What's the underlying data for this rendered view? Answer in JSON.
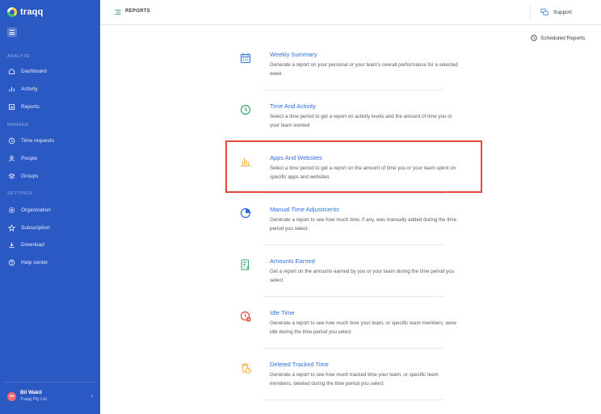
{
  "app": {
    "name": "traqq"
  },
  "sidebar": {
    "sections": {
      "analyze": "ANALYZE",
      "manage": "MANAGE",
      "settings": "SETTINGS"
    },
    "analyze_items": [
      {
        "label": "Dashboard",
        "icon": "home-icon"
      },
      {
        "label": "Activity",
        "icon": "activity-bars-icon"
      },
      {
        "label": "Reports",
        "icon": "reports-icon"
      }
    ],
    "manage_items": [
      {
        "label": "Time requests",
        "icon": "clock-icon"
      },
      {
        "label": "People",
        "icon": "people-icon"
      },
      {
        "label": "Groups",
        "icon": "groups-icon"
      }
    ],
    "settings_items": [
      {
        "label": "Organization",
        "icon": "gear-icon"
      },
      {
        "label": "Subscription",
        "icon": "star-icon"
      },
      {
        "label": "Download",
        "icon": "download-icon"
      },
      {
        "label": "Help center",
        "icon": "help-icon"
      }
    ],
    "user": {
      "name": "Bil Wakil",
      "org": "Traqq Pty Ltd",
      "initials": "BW"
    }
  },
  "header": {
    "title": "REPORTS",
    "support": "Support"
  },
  "scheduled": {
    "label": "Scheduled Reports"
  },
  "reports": [
    {
      "title": "Weekly Summary",
      "desc": "Generate a report on your personal or your team's overall performance for a selected week",
      "icon": "calendar-icon",
      "color": "#2f6fdd"
    },
    {
      "title": "Time And Activity",
      "desc": "Select a time period to get a report on activity levels and the amount of time you or your team worked",
      "icon": "clock-icon",
      "color": "#3aa76d"
    },
    {
      "title": "Apps And Websites",
      "desc": "Select a time period to get a report on the amount of time you or your team spent on specific apps and websites",
      "icon": "bar-chart-icon",
      "color": "#f5a623"
    },
    {
      "title": "Manual Time Adjustments",
      "desc": "Generate a report to see how much time, if any, was manually added during the time period you select",
      "icon": "pie-chart-icon",
      "color": "#2f6fdd"
    },
    {
      "title": "Amounts Earned",
      "desc": "Get a report on the amounts earned by you or your team during the time period you select",
      "icon": "invoice-icon",
      "color": "#3aa76d"
    },
    {
      "title": "Idle Time",
      "desc": "Generate a report to see how much time your team, or specific team members, were idle during the time period you select",
      "icon": "idle-clock-icon",
      "color": "#e24a3b"
    },
    {
      "title": "Deleted Tracked Time",
      "desc": "Generate a report to see how much tracked time your team, or specific team members, deleted during the time period you select",
      "icon": "deleted-time-icon",
      "color": "#f5a623"
    }
  ],
  "colors": {
    "sidebar": "#2b59c3",
    "link": "#2f6fdd",
    "highlight": "#e24a3b"
  }
}
